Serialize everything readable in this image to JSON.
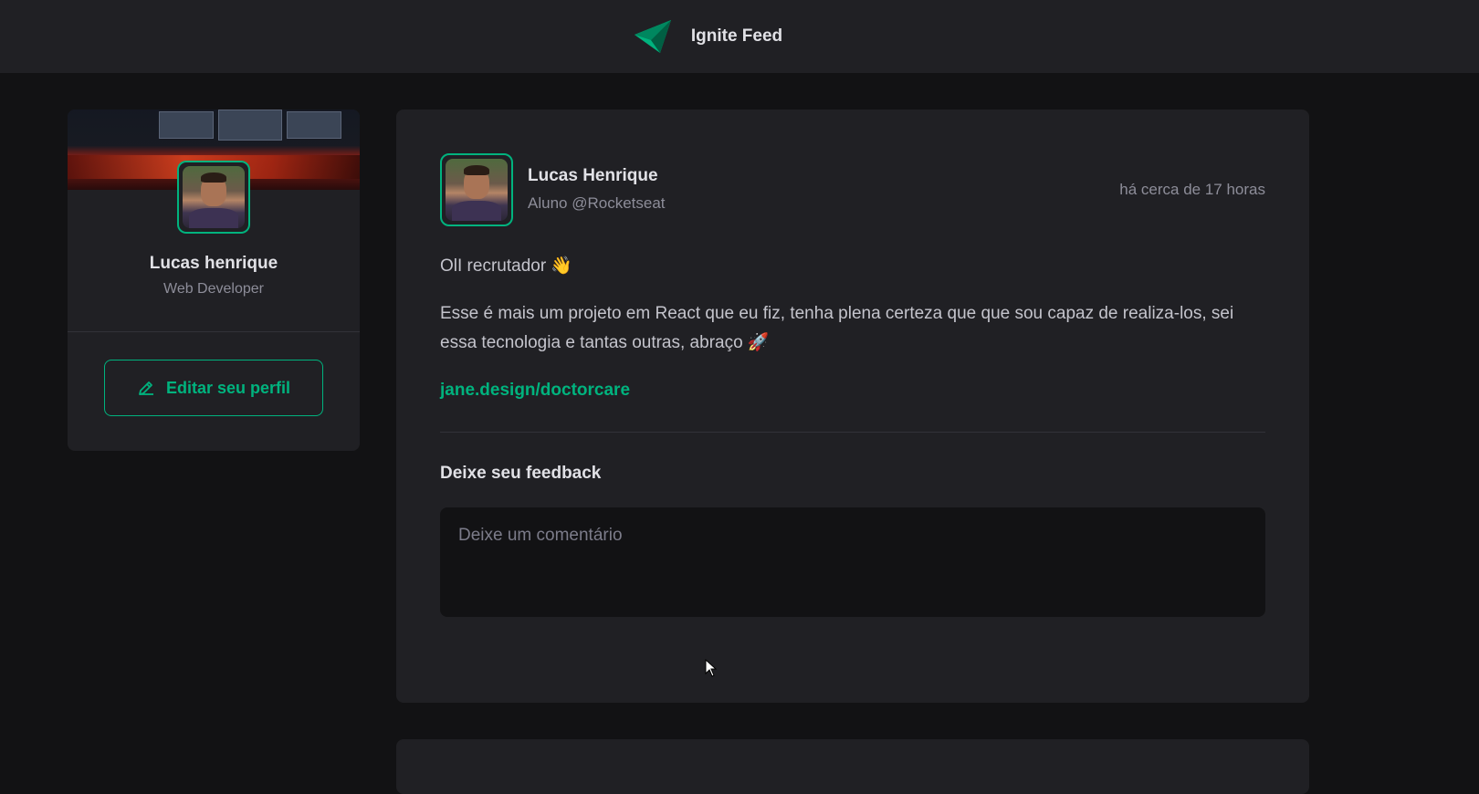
{
  "header": {
    "title": "Ignite Feed",
    "logo_icon": "ignite-logo-icon",
    "accent": "#00b37e"
  },
  "sidebar": {
    "profile": {
      "name": "Lucas henrique",
      "role": "Web Developer"
    },
    "edit_button": {
      "label": "Editar seu perfil",
      "icon": "pencil-icon"
    }
  },
  "post": {
    "author": {
      "name": "Lucas Henrique",
      "role": "Aluno @Rocketseat"
    },
    "time": "há cerca de 17 horas",
    "content": {
      "paragraph1": "OlI recrutador 👋",
      "paragraph2": "Esse é mais um projeto em React que eu fiz, tenha plena certeza que que sou capaz de realiza-los, sei essa tecnologia e tantas outras, abraço 🚀",
      "link": "jane.design/doctorcare"
    },
    "feedback": {
      "title": "Deixe seu feedback",
      "placeholder": "Deixe um comentário",
      "value": ""
    }
  },
  "colors": {
    "background": "#121214",
    "card": "#202024",
    "accent": "#00b37e",
    "muted_text": "#8d8d99"
  }
}
